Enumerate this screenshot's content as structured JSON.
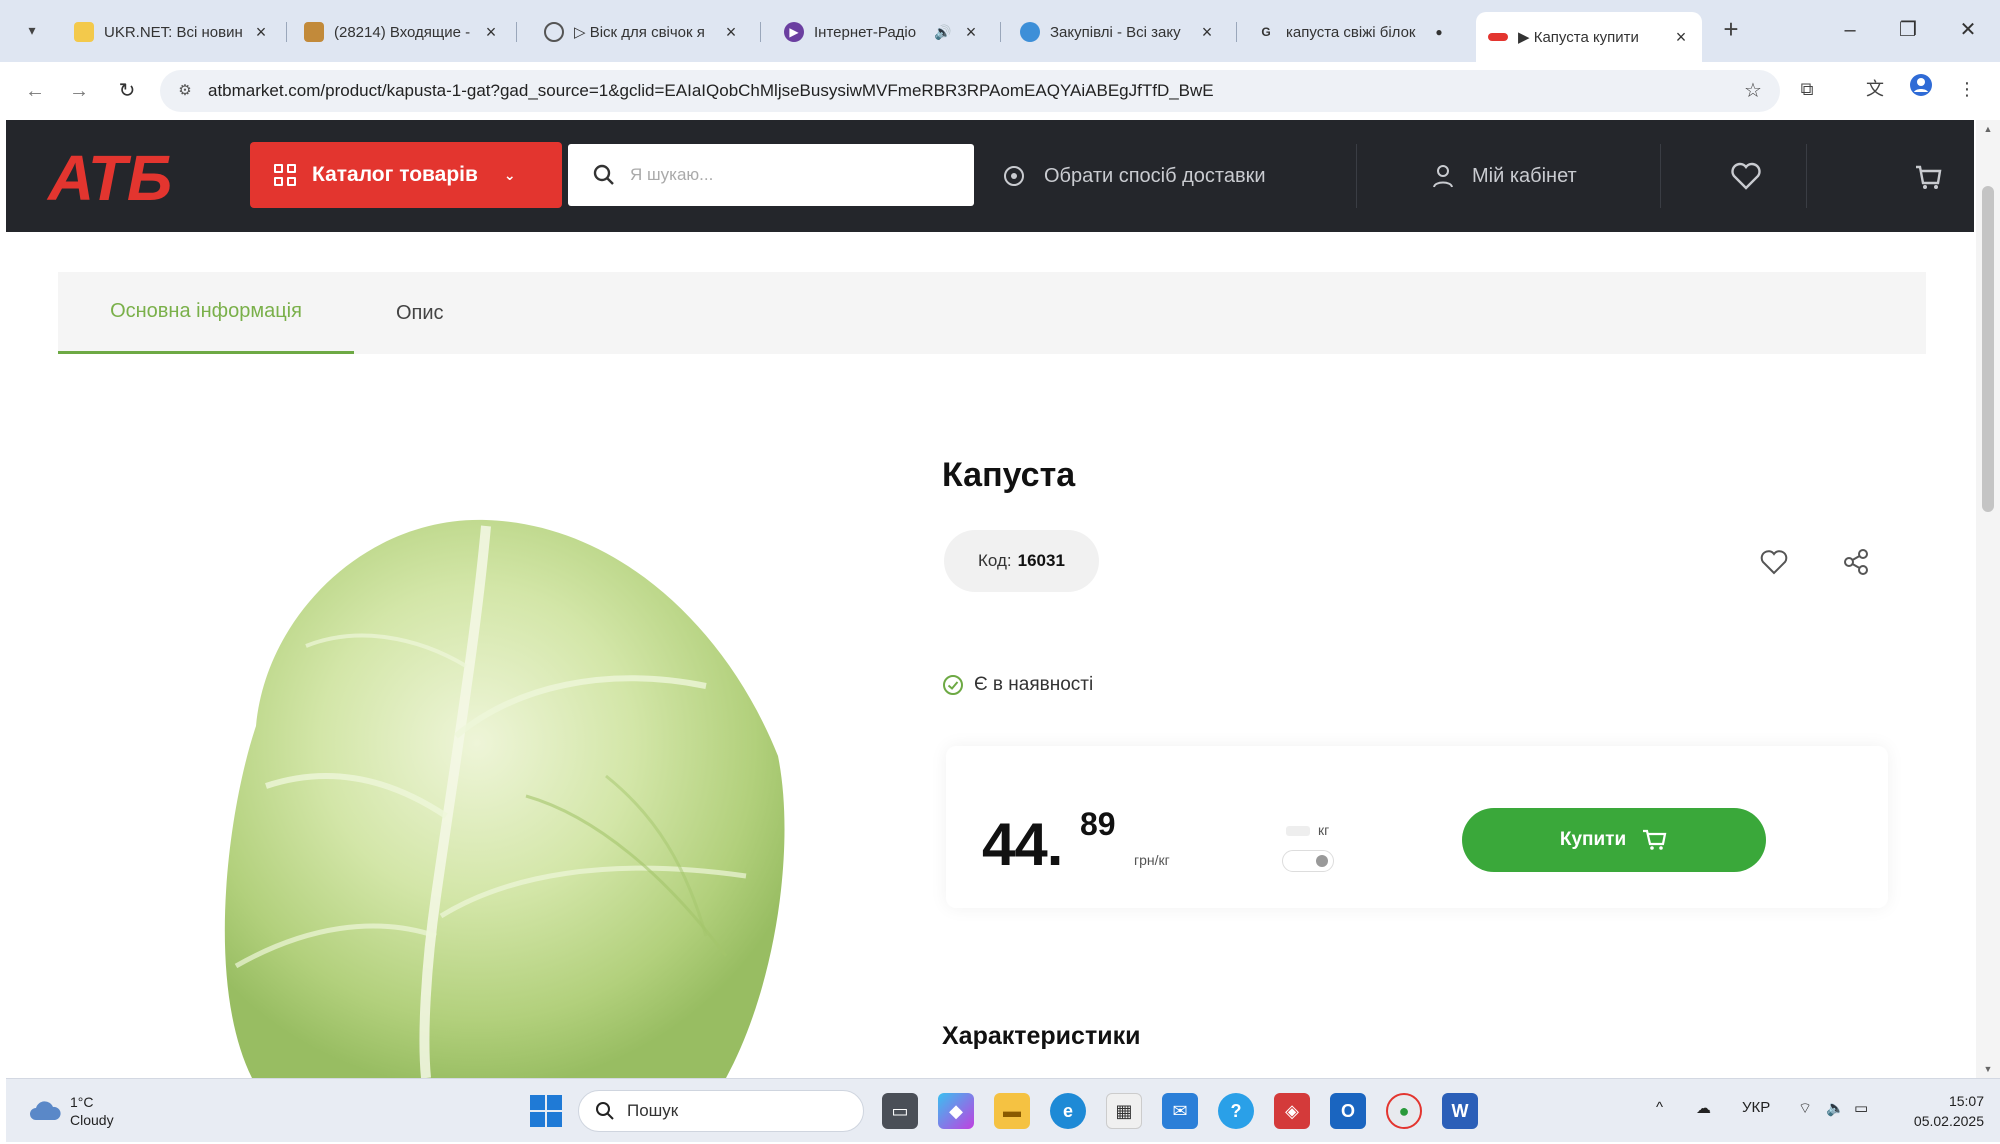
{
  "browser": {
    "tabs": [
      {
        "title": "UKR.NET: Всі новин",
        "active": false
      },
      {
        "title": "(28214) Входящие -",
        "active": false
      },
      {
        "title": "▷ Віск для свічок я",
        "active": false
      },
      {
        "title": "Інтернет-Радіо",
        "active": false
      },
      {
        "title": "Закупівлі - Всі заку",
        "active": false
      },
      {
        "title": "капуста свіжі білок",
        "active": false
      },
      {
        "title": "▶ Капуста купити",
        "active": true
      }
    ],
    "url": "atbmarket.com/product/kapusta-1-gat?gad_source=1&gclid=EAIaIQobChMljseBusysiwMVFmeRBR3RPAomEAQYAiABEgJfTfD_BwE"
  },
  "header": {
    "logo_text": "АТБ",
    "catalog_label": "Каталог товарів",
    "search_placeholder": "Я шукаю...",
    "delivery_label": "Обрати спосіб доставки",
    "account_label": "Мій кабінет"
  },
  "page_tabs": [
    {
      "label": "Основна інформація",
      "active": true
    },
    {
      "label": "Опис",
      "active": false
    }
  ],
  "product": {
    "title": "Капуста",
    "code_label": "Код:",
    "code_value": "16031",
    "stock_label": "Є в наявності",
    "price_int": "44.",
    "price_dec": "89",
    "price_unit": "грн/кг",
    "unit_toggle_label": "кг",
    "buy_label": "Купити",
    "characteristics_title": "Характеристики"
  },
  "taskbar": {
    "weather_temp": "1°C",
    "weather_desc": "Cloudy",
    "search_placeholder": "Пошук",
    "lang": "УКР",
    "time": "15:07",
    "date": "05.02.2025"
  },
  "colors": {
    "brand_red": "#e3352f",
    "header_dark": "#24262b",
    "accent_green": "#3aa83a",
    "tab_active_green": "#7ab04a"
  }
}
